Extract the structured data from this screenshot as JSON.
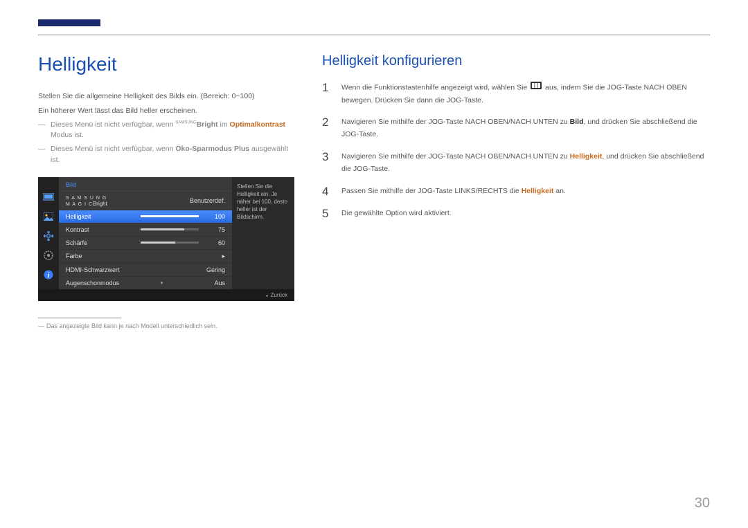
{
  "page_number": "30",
  "left": {
    "title": "Helligkeit",
    "intro1": "Stellen Sie die allgemeine Helligkeit des Bilds ein. (Bereich: 0~100)",
    "intro2": "Ein höherer Wert lässt das Bild heller erscheinen.",
    "note1_pre": "Dieses Menü ist nicht verfügbar, wenn ",
    "note1_magic_small": "SAMSUNG",
    "note1_magic_big": "MAGIC",
    "note1_bright": "Bright",
    "note1_mid": " im ",
    "note1_accent": "Optimalkontrast",
    "note1_post": " Modus ist.",
    "note2_pre": "Dieses Menü ist nicht verfügbar, wenn ",
    "note2_accent": "Öko-Sparmodus Plus",
    "note2_post": " ausgewählt ist.",
    "footnote": "Das angezeigte Bild kann je nach Modell unterschiedlich sein."
  },
  "osd": {
    "header": "Bild",
    "info_text": "Stellen Sie die Helligkeit ein. Je näher bei 100, desto heller ist der Bildschirm.",
    "footer": "Zurück",
    "rows": {
      "r0_label_small": "S A M S U N G",
      "r0_label_big": "M A G I C",
      "r0_label_suffix": "Bright",
      "r0_val": "Benutzerdef.",
      "r1_label": "Helligkeit",
      "r1_val": "100",
      "r2_label": "Kontrast",
      "r2_val": "75",
      "r3_label": "Schärfe",
      "r3_val": "60",
      "r4_label": "Farbe",
      "r4_val": "▸",
      "r5_label": "HDMI-Schwarzwert",
      "r5_val": "Gering",
      "r6_label": "Augenschonmodus",
      "r6_val": "Aus"
    }
  },
  "right": {
    "title": "Helligkeit konfigurieren",
    "s1_pre": "Wenn die Funktionstastenhilfe angezeigt wird, wählen Sie ",
    "s1_post": " aus, indem Sie die JOG-Taste NACH OBEN bewegen. Drücken Sie dann die JOG-Taste.",
    "s2_pre": "Navigieren Sie mithilfe der JOG-Taste NACH OBEN/NACH UNTEN zu ",
    "s2_bold": "Bild",
    "s2_post": ", und drücken Sie abschließend die JOG-Taste.",
    "s3_pre": "Navigieren Sie mithilfe der JOG-Taste NACH OBEN/NACH UNTEN zu ",
    "s3_accent": "Helligkeit",
    "s3_post": ", und drücken Sie abschließend die JOG-Taste.",
    "s4_pre": "Passen Sie mithilfe der JOG-Taste LINKS/RECHTS die ",
    "s4_accent": "Helligkeit",
    "s4_post": " an.",
    "s5": "Die gewählte Option wird aktiviert."
  }
}
